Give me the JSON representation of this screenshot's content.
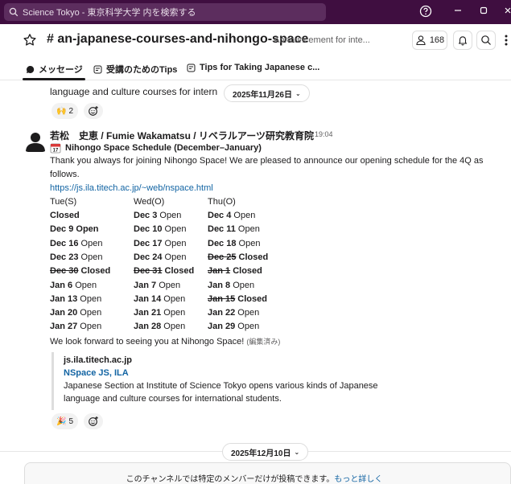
{
  "search": {
    "placeholder": "Science Tokyo - 東京科学大学 内を検索する"
  },
  "topbar": {
    "help_icon": "help-circle-icon",
    "minimize_icon": "minimize-icon",
    "maximize_icon": "maximize-icon",
    "close_icon": "close-icon"
  },
  "channel": {
    "name": "# an-japanese-courses-and-nihongo-space",
    "topic": "Announcement for inte...",
    "member_count": "168"
  },
  "tabs": [
    {
      "label": "メッセージ",
      "icon": "message-icon"
    },
    {
      "label": "受講のためのTips",
      "icon": "canvas-icon"
    },
    {
      "label": "Tips for Taking Japanese c...",
      "icon": "canvas-icon"
    }
  ],
  "prev_message": {
    "partial_line": "language and culture courses for intern",
    "reaction_count": "2",
    "reaction_emoji": "🙌"
  },
  "date_pill_1": "2025年11月26日",
  "message": {
    "author": "若松　史恵 / Fumie Wakamatsu / リベラルアーツ研究教育院",
    "time": "19:04",
    "title": "Nihongo Space Schedule (December–January)",
    "body_line1": "Thank you always for joining Nihongo Space! We are pleased to announce our opening schedule for the 4Q as",
    "body_line2": "follows.",
    "link": "https://js.ila.titech.ac.jp/~web/nspace.html",
    "schedule_header": [
      "Tue(S)",
      "Wed(O)",
      "Thu(O)"
    ],
    "schedule": [
      [
        {
          "d": "Closed",
          "s": ""
        },
        {
          "d": "Dec 3",
          "s": " Open"
        },
        {
          "d": "Dec 4",
          "s": " Open"
        }
      ],
      [
        {
          "d": "Dec 9 Open",
          "s": ""
        },
        {
          "d": "Dec 10",
          "s": " Open"
        },
        {
          "d": "Dec 11",
          "s": " Open"
        }
      ],
      [
        {
          "d": "Dec 16",
          "s": " Open"
        },
        {
          "d": "Dec 17",
          "s": " Open"
        },
        {
          "d": "Dec 18",
          "s": " Open"
        }
      ],
      [
        {
          "d": "Dec 23",
          "s": " Open"
        },
        {
          "d": "Dec 24",
          "s": " Open"
        },
        {
          "d": "Dec 25",
          "s": " Closed",
          "strike": true
        }
      ],
      [
        {
          "d": "Dec 30",
          "s": " Closed",
          "strike": true
        },
        {
          "d": "Dec 31",
          "s": " Closed",
          "strike": true
        },
        {
          "d": "Jan 1",
          "s": " Closed",
          "strike": true
        }
      ],
      [
        {
          "d": "Jan 6",
          "s": " Open"
        },
        {
          "d": "Jan 7",
          "s": " Open"
        },
        {
          "d": "Jan 8",
          "s": " Open"
        }
      ],
      [
        {
          "d": "Jan 13",
          "s": " Open"
        },
        {
          "d": "Jan 14",
          "s": " Open"
        },
        {
          "d": "Jan 15",
          "s": " Closed",
          "strike": true
        }
      ],
      [
        {
          "d": "Jan 20",
          "s": " Open"
        },
        {
          "d": "Jan 21",
          "s": " Open"
        },
        {
          "d": "Jan 22",
          "s": " Open"
        }
      ],
      [
        {
          "d": "Jan 27",
          "s": " Open"
        },
        {
          "d": "Jan 28",
          "s": " Open"
        },
        {
          "d": "Jan 29",
          "s": " Open"
        }
      ]
    ],
    "closing": "We look forward to seeing you at Nihongo Space!",
    "edited": "(編集済み)",
    "unfurl": {
      "site": "js.ila.titech.ac.jp",
      "title": "NSpace JS, ILA",
      "desc1": "Japanese Section at Institute of Science Tokyo opens various kinds of Japanese",
      "desc2": "language and culture courses for international students."
    },
    "reaction_count": "5",
    "reaction_emoji": "🎉"
  },
  "date_pill_2": "2025年12月10日",
  "footer": {
    "text": "このチャンネルでは特定のメンバーだけが投稿できます。",
    "link": "もっと詳しく"
  }
}
